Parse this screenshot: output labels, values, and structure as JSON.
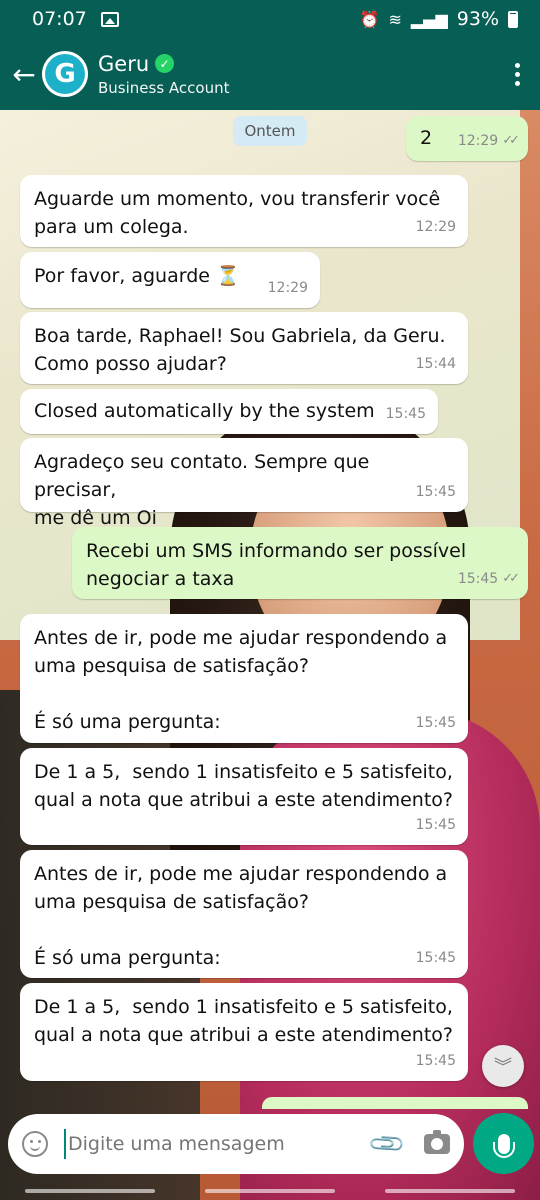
{
  "status_bar": {
    "time": "07:07",
    "battery": "93%"
  },
  "header": {
    "back_icon": "arrow-left-icon",
    "avatar_letter": "G",
    "contact_name": "Geru",
    "subtitle": "Business Account",
    "menu_icon": "more-vert-icon"
  },
  "date_chip": "Ontem",
  "messages": [
    {
      "dir": "out",
      "text": "2",
      "time": "12:29",
      "ticks": "✓✓"
    },
    {
      "dir": "in",
      "text": "Aguarde um momento, vou transferir você\npara um colega.",
      "time": "12:29"
    },
    {
      "dir": "in",
      "text": "Por favor, aguarde ⏳",
      "time": "12:29"
    },
    {
      "dir": "in",
      "text": "Boa tarde, Raphael! Sou Gabriela, da Geru.\nComo posso ajudar?",
      "time": "15:44"
    },
    {
      "dir": "in",
      "text": "Closed automatically by the system",
      "time": "15:45"
    },
    {
      "dir": "in",
      "text": "Agradeço seu contato. Sempre que precisar,\nme dê um Oi",
      "time": "15:45"
    },
    {
      "dir": "out",
      "text": "Recebi um SMS informando ser possível\nnegociar a taxa",
      "time": "15:45",
      "ticks": "✓✓"
    },
    {
      "dir": "in",
      "text": "Antes de ir, pode me ajudar respondendo a\numa pesquisa de satisfação?\n\nÉ só uma pergunta:",
      "time": "15:45"
    },
    {
      "dir": "in",
      "text": "De 1 a 5,  sendo 1 insatisfeito e 5 satisfeito,\nqual a nota que atribui a este atendimento?",
      "time": "15:45"
    },
    {
      "dir": "in",
      "text": "Antes de ir, pode me ajudar respondendo a\numa pesquisa de satisfação?\n\nÉ só uma pergunta:",
      "time": "15:45"
    },
    {
      "dir": "in",
      "text": "De 1 a 5,  sendo 1 insatisfeito e 5 satisfeito,\nqual a nota que atribui a este atendimento?",
      "time": "15:45"
    }
  ],
  "composer": {
    "placeholder": "Digite uma mensagem",
    "emoji_icon": "emoji-icon",
    "attach_icon": "paperclip-icon",
    "camera_icon": "camera-icon",
    "mic_icon": "microphone-icon"
  },
  "colors": {
    "header": "#075e54",
    "outgoing_bubble": "#dcf8c6",
    "incoming_bubble": "#ffffff",
    "accent": "#00a884"
  }
}
